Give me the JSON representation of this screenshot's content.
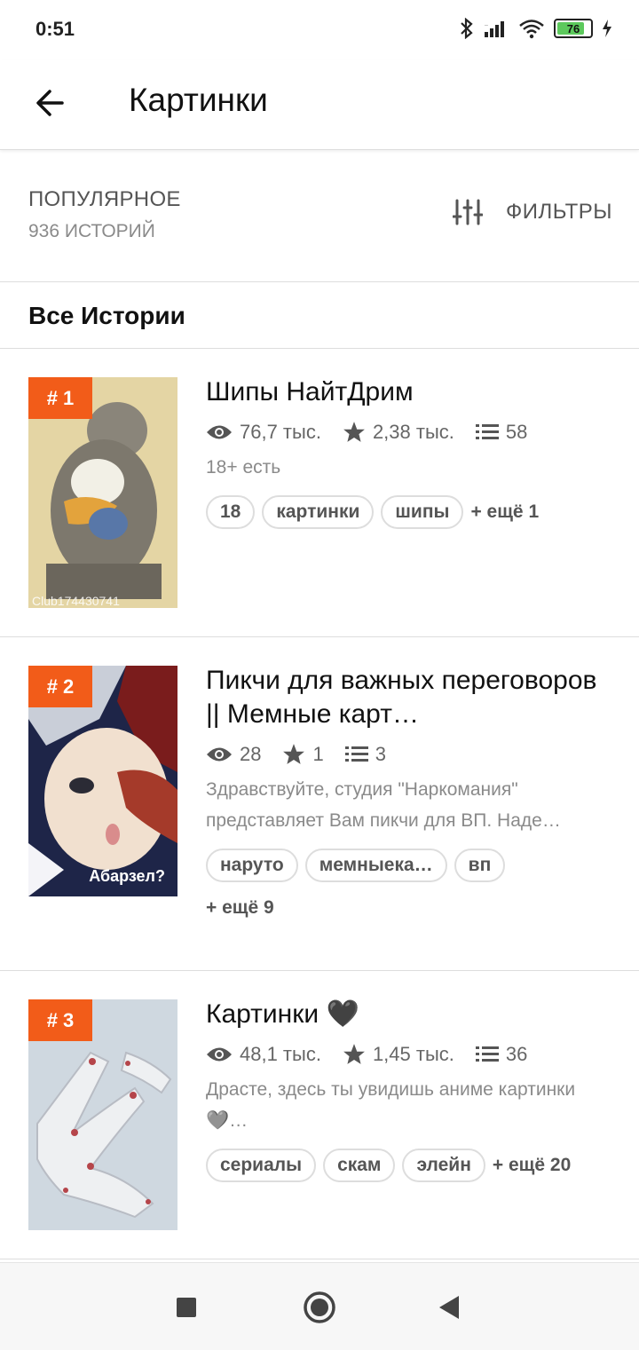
{
  "status": {
    "time": "0:51",
    "battery": "76"
  },
  "header": {
    "back_icon": "arrow-left-icon",
    "title": "Картинки"
  },
  "sort": {
    "label": "ПОПУЛЯРНОЕ",
    "count": "936 ИСТОРИЙ",
    "filters_label": "ФИЛЬТРЫ"
  },
  "section": {
    "title": "Все Истории"
  },
  "stories": [
    {
      "rank": "# 1",
      "title": "Шипы НайтДрим",
      "views": "76,7 тыс.",
      "rating": "2,38 тыс.",
      "chapters": "58",
      "description": "18+ есть",
      "tags": [
        "18",
        "картинки",
        "шипы"
      ],
      "more": "+ ещё 1",
      "thumb_caption": "Club174430741"
    },
    {
      "rank": "# 2",
      "title": "Пикчи для важных переговоров || Мемные карт…",
      "views": "28",
      "rating": "1",
      "chapters": "3",
      "description": "Здравствуйте, студия \"Наркомания\" представляет Вам пикчи для ВП. Наде…",
      "tags": [
        "наруто",
        "мемныека…",
        "вп"
      ],
      "more": "+ ещё 9",
      "thumb_caption": "Абарзел?"
    },
    {
      "rank": "# 3",
      "title": "Картинки 🖤",
      "views": "48,1 тыс.",
      "rating": "1,45 тыс.",
      "chapters": "36",
      "description": "Драсте, здесь ты увидишь аниме картинки 🩶…",
      "tags": [
        "сериалы",
        "скам",
        "элейн"
      ],
      "more": "+ ещё 20"
    }
  ]
}
